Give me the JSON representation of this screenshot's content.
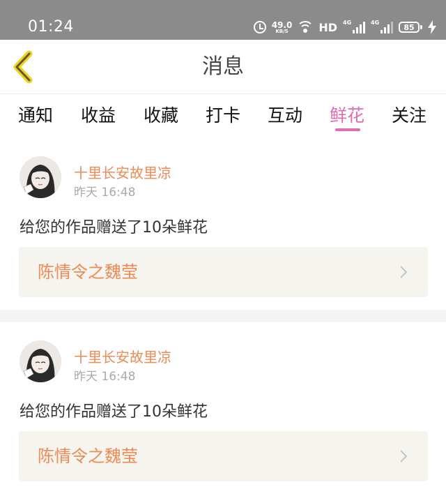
{
  "status_bar": {
    "time": "01:24",
    "net_speed": "49.0",
    "net_unit": "KB/S",
    "hd": "HD",
    "signal1_label": "4G",
    "signal2_label": "4G",
    "battery": "85"
  },
  "header": {
    "title": "消息"
  },
  "tabs": [
    {
      "label": "通知"
    },
    {
      "label": "收益"
    },
    {
      "label": "收藏"
    },
    {
      "label": "打卡"
    },
    {
      "label": "互动"
    },
    {
      "label": "鲜花",
      "active": true
    },
    {
      "label": "关注"
    }
  ],
  "messages": [
    {
      "sender": "十里长安故里凉",
      "time": "昨天 16:48",
      "text": "给您的作品赠送了10朵鲜花",
      "work_title": "陈情令之魏莹"
    },
    {
      "sender": "十里长安故里凉",
      "time": "昨天 16:48",
      "text": "给您的作品赠送了10朵鲜花",
      "work_title": "陈情令之魏莹"
    }
  ],
  "colors": {
    "accent_pink": "#e16db0",
    "sender_orange": "#ee8a55",
    "back_arrow": "#f2d21d",
    "status_bar_bg": "#8b8b8b"
  }
}
